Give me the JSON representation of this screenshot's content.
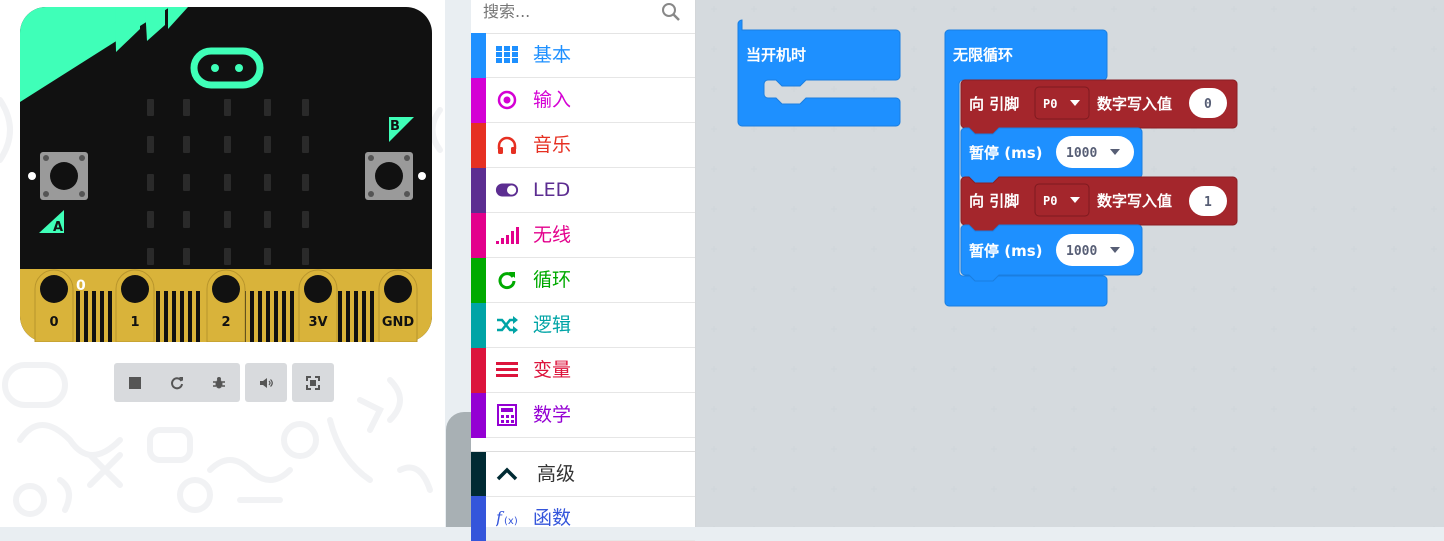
{
  "simulator": {
    "pin_labels": [
      "0",
      "1",
      "2",
      "3V",
      "GND"
    ],
    "pin_touch_indicator": "0",
    "button_a": "A",
    "button_b": "B",
    "controls": [
      {
        "name": "stop",
        "icon": "stop-icon"
      },
      {
        "name": "restart",
        "icon": "restart-icon"
      },
      {
        "name": "debug",
        "icon": "bug-icon"
      },
      {
        "name": "mute",
        "icon": "speaker-icon"
      },
      {
        "name": "fullscreen",
        "icon": "fullscreen-icon"
      }
    ]
  },
  "toolbox": {
    "search_placeholder": "搜索...",
    "categories": [
      {
        "label": "基本",
        "color": "#1e90ff",
        "icon": "grid-icon"
      },
      {
        "label": "输入",
        "color": "#d400d4",
        "icon": "target-icon"
      },
      {
        "label": "音乐",
        "color": "#e63022",
        "icon": "headphones-icon"
      },
      {
        "label": "LED",
        "color": "#5c2d91",
        "icon": "toggle-icon"
      },
      {
        "label": "无线",
        "color": "#e3008c",
        "icon": "signal-icon"
      },
      {
        "label": "循环",
        "color": "#00aa00",
        "icon": "refresh-icon"
      },
      {
        "label": "逻辑",
        "color": "#00a4a6",
        "icon": "shuffle-icon"
      },
      {
        "label": "变量",
        "color": "#dc143c",
        "icon": "list-icon"
      },
      {
        "label": "数学",
        "color": "#9400d3",
        "icon": "calculator-icon"
      }
    ],
    "advanced": {
      "label": "高级",
      "color": "#002a33",
      "icon": "chevron-up-icon"
    },
    "functions": {
      "label": "函数",
      "color": "#3455db",
      "icon": "function-icon"
    }
  },
  "workspace": {
    "on_start": {
      "label": "当开机时",
      "color": "#1e90ff"
    },
    "forever": {
      "label": "无限循环",
      "color": "#1e90ff"
    },
    "blocks": [
      {
        "type": "digital_write",
        "prefix": "向 引脚",
        "pin": "P0",
        "suffix": "数字写入值",
        "value": "0",
        "color": "#a4262c"
      },
      {
        "type": "pause",
        "label": "暂停 (ms)",
        "value": "1000",
        "color": "#1e90ff"
      },
      {
        "type": "digital_write",
        "prefix": "向 引脚",
        "pin": "P0",
        "suffix": "数字写入值",
        "value": "1",
        "color": "#a4262c"
      },
      {
        "type": "pause",
        "label": "暂停 (ms)",
        "value": "1000",
        "color": "#1e90ff"
      }
    ]
  }
}
